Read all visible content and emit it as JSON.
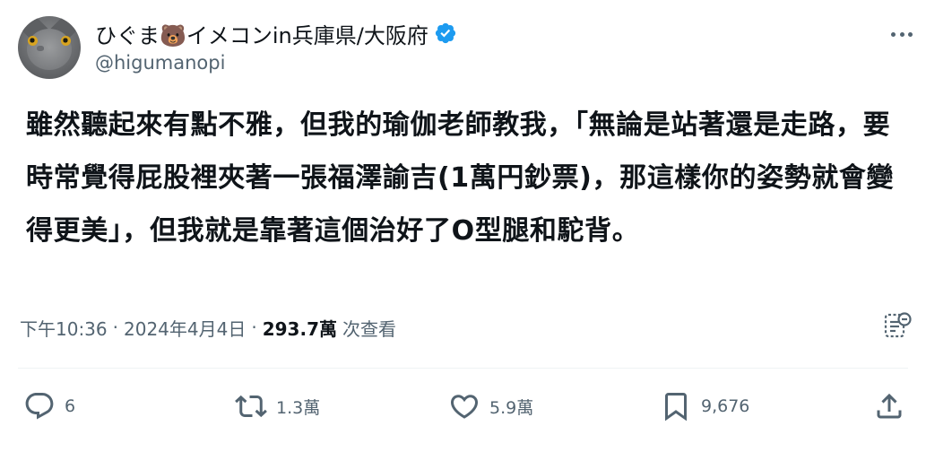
{
  "author": {
    "display_name": "ひぐま🐻イメコンin兵庫県/大阪府",
    "handle": "@higumanopi",
    "verified": true,
    "verified_color": "#1d9bf0"
  },
  "tweet": {
    "text": "雖然聽起來有點不雅，但我的瑜伽老師教我，「無論是站著還是走路，要時常覺得屁股裡夾著一張福澤諭吉(1萬円鈔票)，那這樣你的姿勢就會變得更美」，但我就是靠著這個治好了O型腿和駝背。"
  },
  "meta": {
    "time": "下午10:36",
    "separator": "·",
    "date": "2024年4月4日",
    "views_count": "293.7萬",
    "views_label": "次查看"
  },
  "actions": {
    "reply_count": "6",
    "retweet_count": "1.3萬",
    "like_count": "5.9萬",
    "bookmark_count": "9,676"
  },
  "icons": {
    "more": "more-dots-icon",
    "analytics": "analytics-icon",
    "reply": "reply-icon",
    "retweet": "retweet-icon",
    "like": "heart-icon",
    "bookmark": "bookmark-icon",
    "share": "share-icon"
  },
  "colors": {
    "text": "#0f1419",
    "secondary": "#536471",
    "divider": "#eff3f4"
  }
}
